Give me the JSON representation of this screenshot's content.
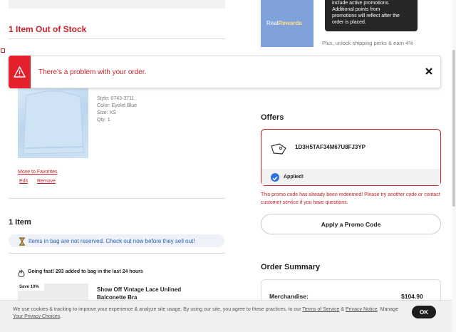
{
  "cart": {
    "out_of_stock_title": "1 Item Out of Stock",
    "oos_item": {
      "style": "Style: 0743-3711",
      "color": "Color: Eyelet Blue",
      "size": "Size: XS",
      "qty": "Qty: 1",
      "move_to_favorites": "Move to Favorites",
      "edit": "Edit",
      "remove": "Remove"
    },
    "items_title": "1 Item",
    "not_reserved_banner": "Items in bag are not reserved. Check out now before they sell out!",
    "going_fast": "Going fast! 293 added to bag in the last 24 hours",
    "item2": {
      "save_tag": "Save 10%",
      "name_line1": "Show Off Vintage Lace Unlined",
      "name_line2": "Balconette Bra"
    }
  },
  "alert": {
    "message": "There's a problem with your order."
  },
  "rewards": {
    "brand_prefix": "Real",
    "brand_suffix": "Rewards",
    "tooltip_lines": [
      "include active promotions.",
      "Additional points from",
      "promotions will reflect after the",
      "order is placed."
    ],
    "note": "Plus, unlock shipping perks & earn 4%"
  },
  "offers": {
    "title": "Offers",
    "promo_code": "1D3H5TAF34M67U8FJ3YP",
    "applied_label": "Applied!",
    "error_message": "This promo code has already been redeemed! Please try another code or contact customer service if you have questions.",
    "apply_button": "Apply a Promo Code"
  },
  "summary": {
    "title": "Order Summary",
    "merchandise_label": "Merchandise:",
    "merchandise_value": "$104.90"
  },
  "cookie": {
    "text_part1": "We use cookies & tracking to improve your experience & analyze site usage. By using our site, you agree to these practices, to our ",
    "terms_link": "Terms of Service",
    "and": " & ",
    "privacy_link": "Privacy Notice",
    "text_part2": ". Manage ",
    "choices_link": "Your Privacy Choices",
    "end": ".",
    "ok_label": "OK"
  },
  "colors": {
    "accent_red": "#c8202b",
    "alert_red": "#e5202d",
    "link_blue": "#2b5fb0",
    "applied_blue": "#2f6fe0"
  }
}
